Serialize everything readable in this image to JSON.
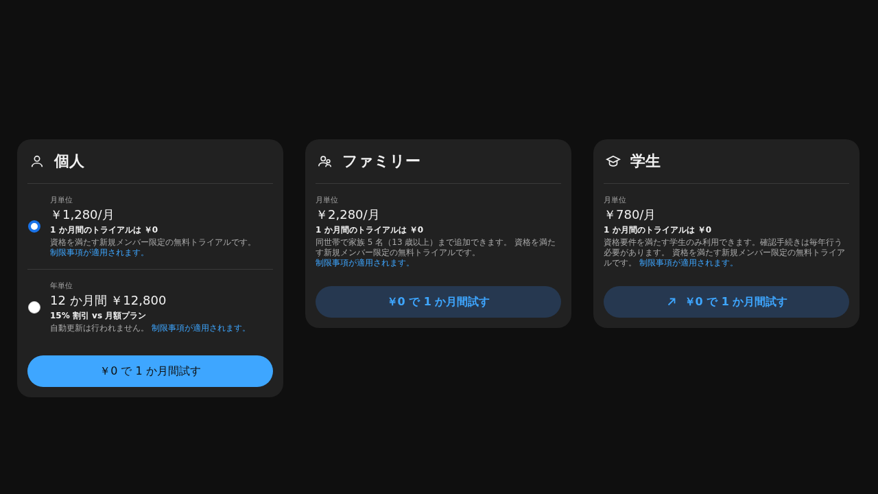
{
  "plans": [
    {
      "kind": "person",
      "title": "個人",
      "options": [
        {
          "selected": true,
          "period": "月単位",
          "price": "￥1,280/月",
          "trial": "1 か月間のトライアルは ￥0",
          "description": "資格を満たす新規メンバー限定の無料トライアルです。",
          "link": "制限事項が適用されます。"
        },
        {
          "selected": false,
          "period": "年単位",
          "price": "12 か月間 ￥12,800",
          "trial": "15% 割引 vs 月額プラン",
          "description": "自動更新は行われません。",
          "link": "制限事項が適用されます。"
        }
      ],
      "button": {
        "label": "￥0 で 1 か月間試す",
        "kind": "filled",
        "external": false
      }
    },
    {
      "kind": "family",
      "title": "ファミリー",
      "options": [
        {
          "period": "月単位",
          "price": "￥2,280/月",
          "trial": "1 か月間のトライアルは ￥0",
          "description": "同世帯で家族 5 名（13 歳以上）まで追加できます。 資格を満たす新規メンバー限定の無料トライアルです。",
          "link": "制限事項が適用されます。"
        }
      ],
      "button": {
        "label": "￥0 で 1 か月間試す",
        "kind": "tonal",
        "external": false
      }
    },
    {
      "kind": "student",
      "title": "学生",
      "options": [
        {
          "period": "月単位",
          "price": "￥780/月",
          "trial": "1 か月間のトライアルは ￥0",
          "description": "資格要件を満たす学生のみ利用できます。確認手続きは毎年行う必要があります。 資格を満たす新規メンバー限定の無料トライアルです。",
          "link": "制限事項が適用されます。"
        }
      ],
      "button": {
        "label": "￥0 で 1 か月間試す",
        "kind": "tonal",
        "external": true
      }
    }
  ]
}
